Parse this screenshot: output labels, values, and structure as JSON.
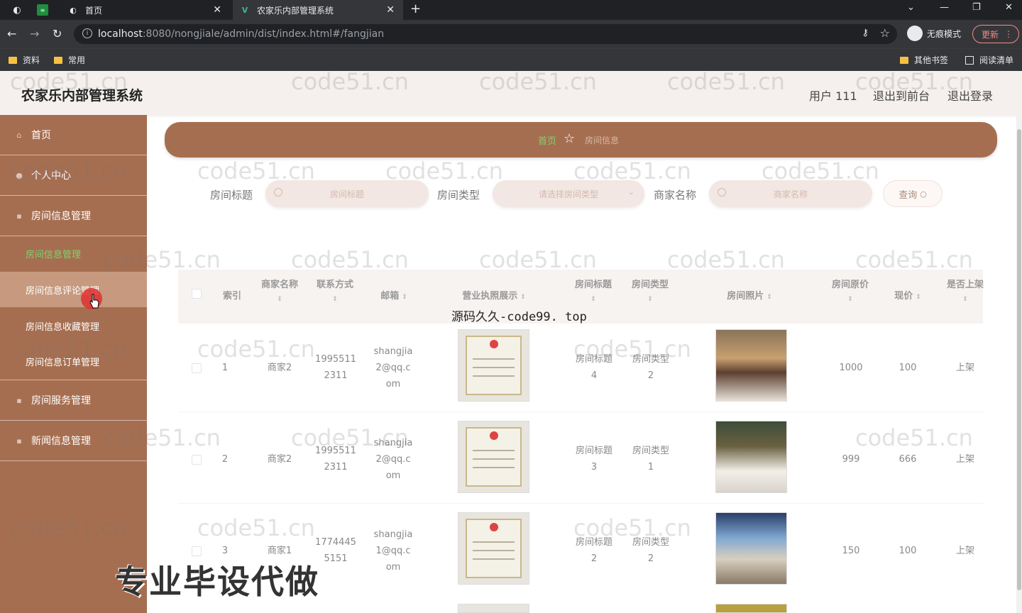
{
  "browser": {
    "tabs": [
      {
        "label": "首页"
      },
      {
        "label": "农家乐内部管理系统"
      }
    ],
    "url_host": "localhost",
    "url_rest": ":8080/nongjiale/admin/dist/index.html#/fangjian",
    "incognito_label": "无痕模式",
    "update_label": "更新",
    "bookmarks": [
      "资料",
      "常用"
    ],
    "bookmarks_right": [
      "其他书签",
      "阅读清单"
    ]
  },
  "header": {
    "title": "农家乐内部管理系统",
    "user": "用户 111",
    "back_front": "退出到前台",
    "logout": "退出登录"
  },
  "sidebar": {
    "items": [
      {
        "label": "首页"
      },
      {
        "label": "个人中心"
      },
      {
        "label": "房间信息管理"
      },
      {
        "label": "房间服务管理"
      },
      {
        "label": "新闻信息管理"
      }
    ],
    "sub_items": [
      {
        "label": "房间信息管理"
      },
      {
        "label": "房间信息评论管理"
      },
      {
        "label": "房间信息收藏管理"
      },
      {
        "label": "房间信息订单管理"
      }
    ]
  },
  "breadcrumb": {
    "home": "首页",
    "current": "房间信息"
  },
  "search": {
    "title_label": "房间标题",
    "title_placeholder": "房间标题",
    "type_label": "房间类型",
    "type_placeholder": "请选择房间类型",
    "merchant_label": "商家名称",
    "merchant_placeholder": "商家名称",
    "query_label": "查询"
  },
  "table": {
    "headers": {
      "index": "索引",
      "merchant": "商家名称",
      "contact": "联系方式",
      "email": "邮箱",
      "license": "营业执照展示",
      "title": "房间标题",
      "type": "房间类型",
      "photo": "房间照片",
      "orig_price": "房间原价",
      "price": "现价",
      "on_shelf": "是否上架"
    },
    "rows": [
      {
        "index": "1",
        "merchant": "商家2",
        "contact_a": "1995511",
        "contact_b": "2311",
        "email_a": "shangjia",
        "email_b": "2@qq.c",
        "email_c": "om",
        "title_a": "房间标题",
        "title_b": "4",
        "type_a": "房间类型",
        "type_b": "2",
        "orig_price": "1000",
        "price": "100",
        "on_shelf": "上架"
      },
      {
        "index": "2",
        "merchant": "商家2",
        "contact_a": "1995511",
        "contact_b": "2311",
        "email_a": "shangjia",
        "email_b": "2@qq.c",
        "email_c": "om",
        "title_a": "房间标题",
        "title_b": "3",
        "type_a": "房间类型",
        "type_b": "1",
        "orig_price": "999",
        "price": "666",
        "on_shelf": "上架"
      },
      {
        "index": "3",
        "merchant": "商家1",
        "contact_a": "1774445",
        "contact_b": "5151",
        "email_a": "shangjia",
        "email_b": "1@qq.c",
        "email_c": "om",
        "title_a": "房间标题",
        "title_b": "2",
        "type_a": "房间类型",
        "type_b": "2",
        "orig_price": "150",
        "price": "100",
        "on_shelf": "上架"
      }
    ]
  },
  "overlays": {
    "source_text": "源码久久-code99. top",
    "promo_text": "专业毕设代做",
    "watermark": "code51.cn"
  }
}
